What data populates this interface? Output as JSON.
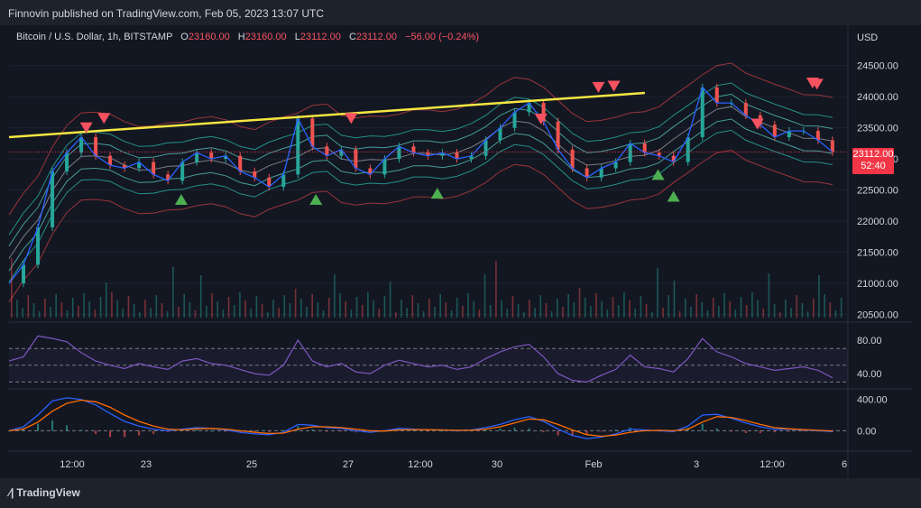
{
  "header": {
    "published": "Finnovin published on TradingView.com, Feb 05, 2023 13:07 UTC"
  },
  "legend": {
    "symbol": "Bitcoin / U.S. Dollar, 1h, BITSTAMP",
    "o_label": "O",
    "o_value": "23160.00",
    "h_label": "H",
    "h_value": "23160.00",
    "l_label": "L",
    "l_value": "23112.00",
    "c_label": "C",
    "c_value": "23112.00",
    "change": "−56.00 (−0.24%)"
  },
  "price_tag": {
    "price": "23112.00",
    "countdown": "52:40"
  },
  "footer": {
    "brand": "TradingView"
  },
  "colors": {
    "background": "#131722",
    "trendline": "#f5e642",
    "sell_marker": "#f7525f",
    "buy_marker": "#4caf50",
    "rsi": "#7e57c2",
    "macd": "#2962ff",
    "signal": "#ff6d00"
  },
  "chart_data": [
    {
      "type": "line",
      "panel": "price",
      "currency": "USD",
      "ylim": [
        20450,
        24800
      ],
      "y_ticks": [
        "24500.00",
        "24000.00",
        "23500.00",
        "23000.00",
        "22500.00",
        "22000.00",
        "21500.00",
        "21000.00",
        "20500.00"
      ],
      "y_tick_values": [
        24500,
        24000,
        23500,
        23000,
        22500,
        22000,
        21500,
        21000,
        20500
      ],
      "x_ticks": [
        "12:00",
        "23",
        "25",
        "27",
        "12:00",
        "30",
        "Feb",
        "3",
        "12:00",
        "6"
      ],
      "x": [
        0,
        0.5,
        1,
        1.5,
        2,
        2.5,
        3,
        3.5,
        4,
        4.5,
        5,
        5.5,
        6,
        6.5,
        7,
        7.5,
        8,
        8.5,
        9,
        9.5,
        10,
        10.5,
        11,
        11.5,
        12,
        12.5,
        13,
        13.5,
        14,
        14.5,
        15,
        15.5,
        16,
        16.5,
        17,
        17.5,
        18,
        18.5,
        19,
        19.5,
        20,
        20.5,
        21,
        21.5,
        22,
        22.5,
        23,
        23.5,
        24,
        24.5,
        25,
        25.5,
        26,
        26.5,
        27,
        27.5,
        28,
        28.5
      ],
      "close": [
        21000,
        21300,
        21900,
        22800,
        23100,
        23350,
        23050,
        22900,
        22850,
        22950,
        22750,
        22650,
        22950,
        23100,
        23000,
        23050,
        22800,
        22700,
        22550,
        22750,
        23650,
        23200,
        23050,
        23150,
        22850,
        22750,
        23000,
        23200,
        23100,
        23050,
        23100,
        23000,
        23050,
        23300,
        23500,
        23750,
        23900,
        23600,
        23150,
        22850,
        22700,
        22850,
        22950,
        23250,
        23100,
        23050,
        22950,
        23350,
        24150,
        23900,
        23900,
        23700,
        23550,
        23350,
        23450,
        23450,
        23300,
        23112
      ],
      "trendline": {
        "start": [
          0,
          23350
        ],
        "end": [
          28.8,
          24060
        ]
      },
      "sell_signals": [
        {
          "x": 3.5,
          "y": 23500
        },
        {
          "x": 4.3,
          "y": 23650
        },
        {
          "x": 15.5,
          "y": 23650
        },
        {
          "x": 24.1,
          "y": 23640
        },
        {
          "x": 26.7,
          "y": 24150
        },
        {
          "x": 27.4,
          "y": 24170
        },
        {
          "x": 33.9,
          "y": 23560
        },
        {
          "x": 36.4,
          "y": 24220
        },
        {
          "x": 36.6,
          "y": 24200
        }
      ],
      "buy_signals": [
        {
          "x": 7.8,
          "y": 22350
        },
        {
          "x": 13.9,
          "y": 22350
        },
        {
          "x": 19.4,
          "y": 22450
        },
        {
          "x": 29.4,
          "y": 22750
        },
        {
          "x": 30.1,
          "y": 22400
        }
      ]
    },
    {
      "type": "line",
      "panel": "rsi",
      "y_ticks": [
        "80.00",
        "40.00"
      ],
      "y_tick_values": [
        80,
        40
      ],
      "ylim": [
        25,
        95
      ],
      "guides": [
        70,
        50,
        30
      ],
      "values": [
        55,
        60,
        85,
        82,
        78,
        65,
        55,
        50,
        46,
        52,
        48,
        45,
        55,
        58,
        52,
        50,
        45,
        40,
        38,
        50,
        80,
        55,
        48,
        52,
        42,
        40,
        50,
        56,
        52,
        48,
        50,
        45,
        48,
        58,
        66,
        72,
        75,
        60,
        40,
        32,
        30,
        38,
        45,
        62,
        48,
        46,
        42,
        58,
        82,
        66,
        60,
        52,
        48,
        44,
        46,
        48,
        44,
        35
      ]
    },
    {
      "type": "line",
      "panel": "macd",
      "y_ticks": [
        "400.00",
        "0.00"
      ],
      "y_tick_values": [
        400,
        0
      ],
      "ylim": [
        -180,
        500
      ],
      "series": [
        {
          "values": [
            0,
            50,
            200,
            380,
            420,
            400,
            330,
            220,
            120,
            60,
            20,
            0,
            20,
            40,
            30,
            10,
            -20,
            -40,
            -50,
            -20,
            80,
            70,
            40,
            30,
            0,
            -20,
            0,
            30,
            20,
            10,
            10,
            0,
            10,
            40,
            80,
            140,
            180,
            120,
            20,
            -60,
            -100,
            -80,
            -40,
            20,
            10,
            0,
            -10,
            60,
            200,
            210,
            160,
            100,
            50,
            20,
            20,
            10,
            0,
            -10
          ]
        },
        {
          "values": [
            0,
            20,
            110,
            250,
            350,
            390,
            370,
            300,
            200,
            120,
            60,
            20,
            10,
            25,
            30,
            20,
            0,
            -20,
            -35,
            -30,
            20,
            50,
            50,
            40,
            20,
            0,
            -5,
            10,
            15,
            12,
            10,
            5,
            5,
            20,
            50,
            100,
            150,
            140,
            80,
            10,
            -50,
            -70,
            -55,
            -20,
            0,
            5,
            0,
            20,
            110,
            180,
            170,
            130,
            80,
            40,
            25,
            15,
            5,
            -2
          ]
        }
      ]
    }
  ]
}
